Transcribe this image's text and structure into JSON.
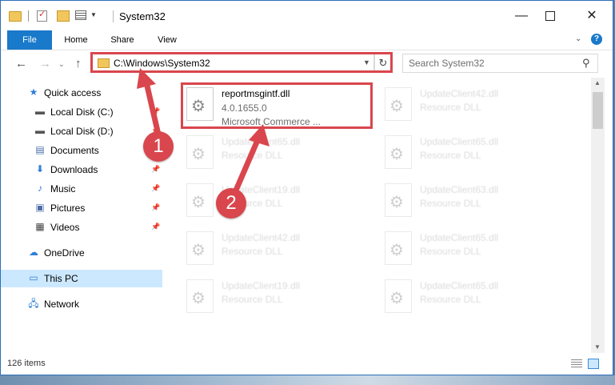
{
  "window": {
    "title": "System32"
  },
  "ribbon": {
    "tabs": [
      {
        "label": "File"
      },
      {
        "label": "Home"
      },
      {
        "label": "Share"
      },
      {
        "label": "View"
      }
    ]
  },
  "address": {
    "path": "C:\\Windows\\System32"
  },
  "search": {
    "placeholder": "Search System32"
  },
  "sidebar": {
    "items": [
      {
        "label": "Quick access"
      },
      {
        "label": "Local Disk (C:)"
      },
      {
        "label": "Local Disk (D:)"
      },
      {
        "label": "Documents"
      },
      {
        "label": "Downloads"
      },
      {
        "label": "Music"
      },
      {
        "label": "Pictures"
      },
      {
        "label": "Videos"
      },
      {
        "label": "OneDrive"
      },
      {
        "label": "This PC"
      },
      {
        "label": "Network"
      }
    ]
  },
  "files": {
    "highlighted": {
      "name": "reportmsgintf.dll",
      "version": "4.0.1655.0",
      "company": "Microsoft Commerce ..."
    },
    "right_col": [
      {
        "name": "UpdateClient42.dll",
        "type": "Resource DLL"
      },
      {
        "name": "UpdateClient65.dll",
        "type": "Resource DLL"
      },
      {
        "name": "UpdateClient63.dll",
        "type": "Resource DLL"
      },
      {
        "name": "UpdateClient65.dll",
        "type": "Resource DLL"
      },
      {
        "name": "UpdateClient65.dll",
        "type": "Resource DLL"
      }
    ],
    "left_col": [
      {
        "name": "UpdateClient65.dll",
        "type": "Resource DLL"
      },
      {
        "name": "UpdateClient19.dll",
        "type": "Resource DLL"
      },
      {
        "name": "UpdateClient42.dll",
        "type": "Resource DLL"
      },
      {
        "name": "UpdateClient19.dll",
        "type": "Resource DLL"
      }
    ]
  },
  "status": {
    "item_count": "126 items"
  },
  "callouts": {
    "one": "1",
    "two": "2"
  },
  "colors": {
    "accent": "#1979ca",
    "highlight": "#d9464d",
    "selected": "#cce8ff"
  },
  "icons": [
    "folder-icon",
    "properties-icon",
    "new-folder-icon",
    "view-icon",
    "back-arrow-icon",
    "forward-arrow-icon",
    "up-arrow-icon",
    "refresh-icon",
    "search-icon",
    "star-icon",
    "drive-icon",
    "documents-icon",
    "downloads-icon",
    "music-icon",
    "pictures-icon",
    "videos-icon",
    "cloud-icon",
    "computer-icon",
    "network-icon",
    "pin-icon",
    "gear-dll-icon"
  ]
}
